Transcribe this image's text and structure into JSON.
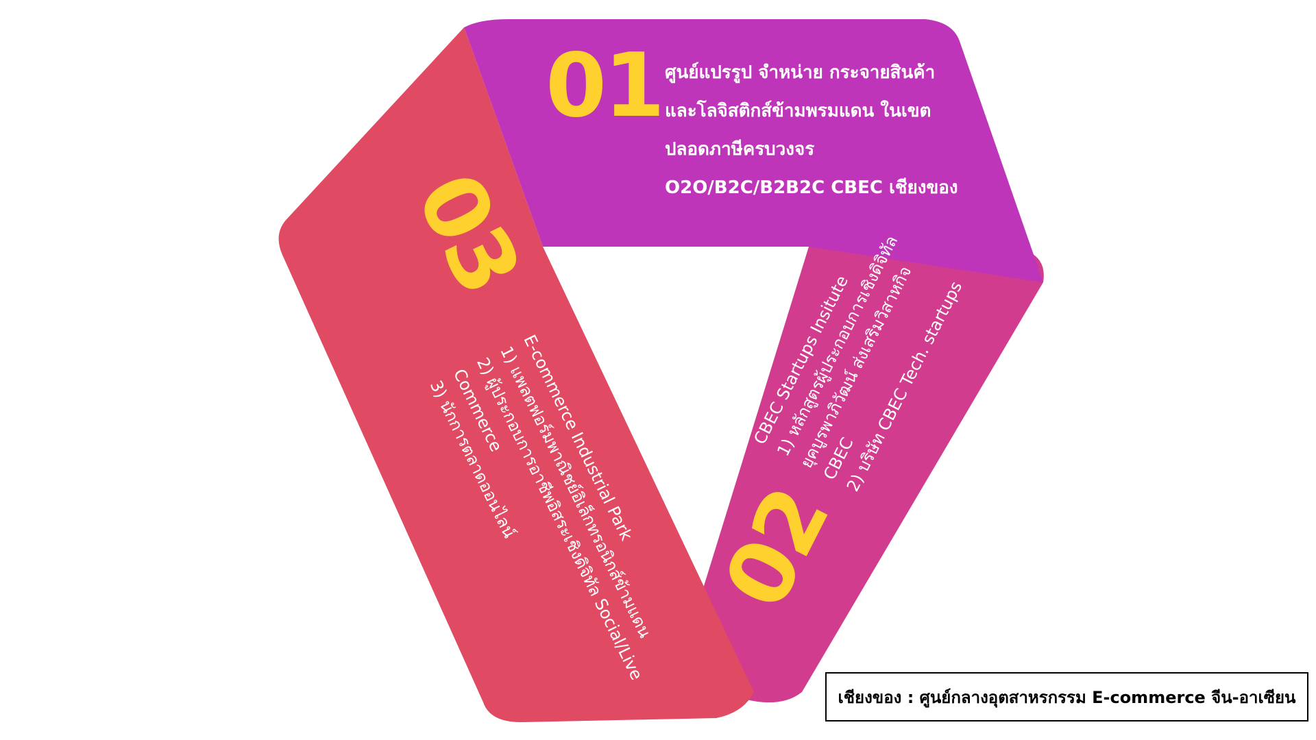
{
  "colors": {
    "band1": "#BE35B9",
    "band2": "#D23C8E",
    "band3": "#E04A62",
    "number": "#FFD12E",
    "text": "#FFFFFF"
  },
  "segment1": {
    "number": "01",
    "lines": [
      "ศูนย์แปรรูป จำหน่าย กระจายสินค้า",
      "และโลจิสติกส์ข้ามพรมแดน ในเขต",
      "ปลอดภาษีครบวงจร",
      "O2O/B2C/B2B2C CBEC เชียงของ"
    ]
  },
  "segment2": {
    "number": "02",
    "lines": [
      "CBEC Startups Insitute",
      "1) หลักสูตรผู้ประกอบการเชิงดิจิทัล",
      "ยุคบูรพาภิวัฒน์ ส่งเสริมวิสาหกิจ",
      "CBEC",
      "2) บริษัท CBEC Tech. startups"
    ]
  },
  "segment3": {
    "number": "03",
    "lines": [
      "E-commerce Industrial Park",
      "1) แพลตฟอร์มพาณิชย์อิเล็กทรอนิกส์ข้ามแดน",
      "2) ผู้ประกอบการอาชีพอิสระเชิงดิจิทัล Social/Live",
      "Commerce",
      "3) นักการตลาดออนไลน์"
    ]
  },
  "caption": "เชียงของ : ศูนย์กลางอุตสาหรกรรม E-commerce จีน-อาเซียน"
}
